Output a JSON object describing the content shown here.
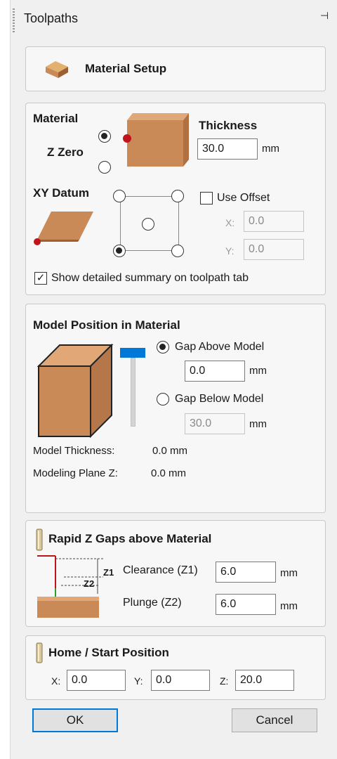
{
  "panel": {
    "title": "Toolpaths"
  },
  "material_setup": {
    "label": "Material Setup"
  },
  "material": {
    "heading": "Material",
    "z_zero_label": "Z Zero",
    "thickness_label": "Thickness",
    "thickness_value": "30.0",
    "thickness_unit": "mm",
    "xy_datum_label": "XY Datum",
    "use_offset_label": "Use Offset",
    "use_offset_checked": false,
    "offset_x_label": "X:",
    "offset_x_value": "0.0",
    "offset_y_label": "Y:",
    "offset_y_value": "0.0",
    "show_summary_label": "Show detailed summary on toolpath tab",
    "show_summary_checked": true
  },
  "model_position": {
    "heading": "Model Position in Material",
    "gap_above_label": "Gap Above Model",
    "gap_above_value": "0.0",
    "gap_above_unit": "mm",
    "gap_below_label": "Gap Below Model",
    "gap_below_value": "30.0",
    "gap_below_unit": "mm",
    "model_thickness_label": "Model Thickness:",
    "model_thickness_value": "0.0 mm",
    "modeling_plane_label": "Modeling Plane Z:",
    "modeling_plane_value": "0.0 mm"
  },
  "rapid_z": {
    "heading": "Rapid Z Gaps above Material",
    "z1_tag": "Z1",
    "z2_tag": "Z2",
    "clearance_label": "Clearance (Z1)",
    "clearance_value": "6.0",
    "clearance_unit": "mm",
    "plunge_label": "Plunge (Z2)",
    "plunge_value": "6.0",
    "plunge_unit": "mm"
  },
  "home": {
    "heading": "Home / Start Position",
    "x_label": "X:",
    "x_value": "0.0",
    "y_label": "Y:",
    "y_value": "0.0",
    "z_label": "Z:",
    "z_value": "20.0"
  },
  "buttons": {
    "ok": "OK",
    "cancel": "Cancel"
  },
  "colors": {
    "wood": "#c98a58",
    "wood_dark": "#9c5e33",
    "accent": "#0078d7",
    "datum_dot": "#c0141c"
  }
}
